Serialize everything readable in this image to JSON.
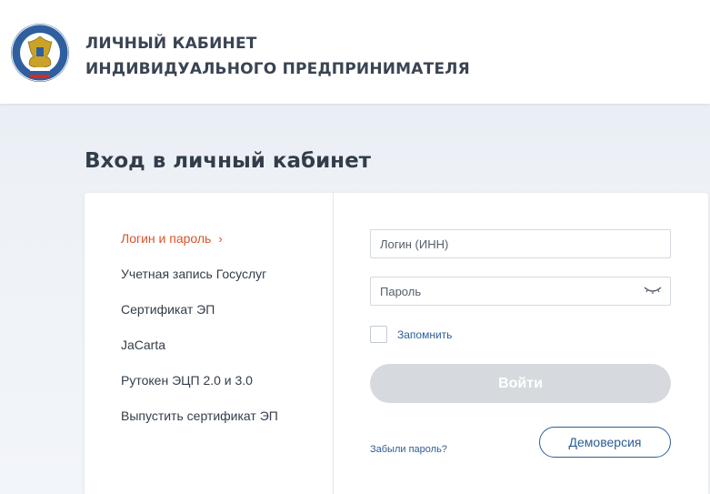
{
  "header": {
    "title_line1": "ЛИЧНЫЙ КАБИНЕТ",
    "title_line2": "ИНДИВИДУАЛЬНОГО ПРЕДПРИНИМАТЕЛЯ",
    "logo_icon": "fns-emblem-icon"
  },
  "page": {
    "title": "Вход в личный кабинет"
  },
  "methods": [
    {
      "label": "Логин и пароль",
      "active": true
    },
    {
      "label": "Учетная запись Госуслуг",
      "active": false
    },
    {
      "label": "Сертификат ЭП",
      "active": false
    },
    {
      "label": "JaCarta",
      "active": false
    },
    {
      "label": "Рутокен ЭЦП 2.0 и 3.0",
      "active": false
    },
    {
      "label": "Выпустить сертификат ЭП",
      "active": false
    }
  ],
  "form": {
    "login_placeholder": "Логин (ИНН)",
    "login_value": "",
    "password_placeholder": "Пароль",
    "password_value": "",
    "remember_label": "Запомнить",
    "remember_checked": false,
    "login_button": "Войти",
    "forgot_link": "Забыли пароль?",
    "demo_button": "Демоверсия"
  },
  "colors": {
    "accent_active": "#d9542b",
    "link": "#2c5d94",
    "button_disabled": "#d6dadf",
    "text": "#333d4a"
  }
}
